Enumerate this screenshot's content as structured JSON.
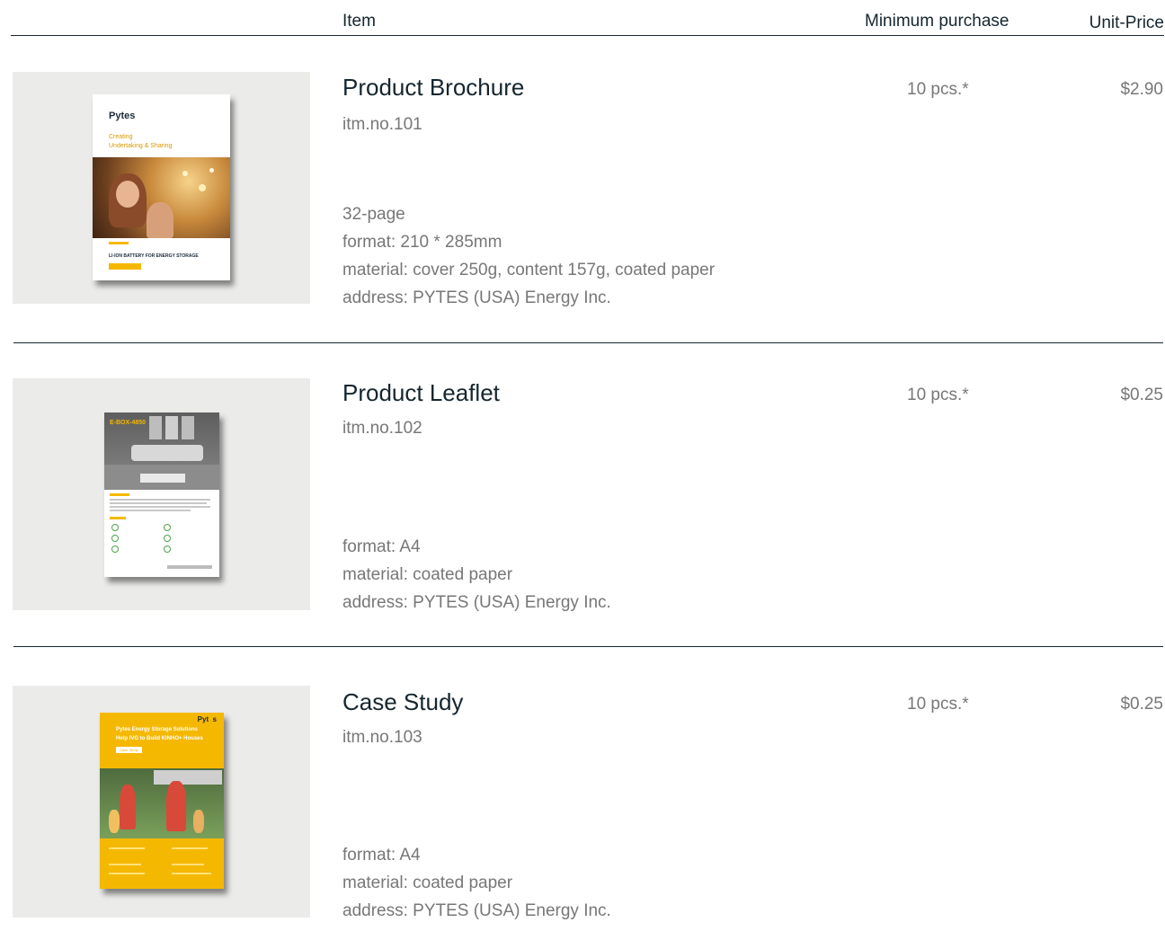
{
  "header": {
    "item_label": "Item",
    "min_purchase_label": "Minimum purchase",
    "unit_price_label": "Unit-Price"
  },
  "products": [
    {
      "title": "Product Brochure",
      "item_no": "itm.no.101",
      "specs": [
        "32-page",
        "format: 210 * 285mm",
        "material: cover 250g, content 157g, coated paper",
        "address: PYTES (USA) Energy Inc."
      ],
      "min_purchase": "10 pcs.*",
      "price": "$2.90",
      "thumb": {
        "brand": "Pytes",
        "headline_1": "Creating",
        "headline_2": "Undertaking & Sharing",
        "footer": "LI-ION BATTERY FOR ENERGY STORAGE"
      }
    },
    {
      "title": "Product Leaflet",
      "item_no": "itm.no.102",
      "specs": [
        "format: A4",
        "material: coated paper",
        "address: PYTES (USA) Energy Inc."
      ],
      "min_purchase": "10 pcs.*",
      "price": "$0.25",
      "thumb": {
        "model": "E-BOX-4850"
      }
    },
    {
      "title": "Case Study",
      "item_no": "itm.no.103",
      "specs": [
        "format: A4",
        "material: coated paper",
        "address: PYTES (USA) Energy Inc."
      ],
      "min_purchase": "10 pcs.*",
      "price": "$0.25",
      "thumb": {
        "brand": "Pyt  s",
        "headline_1": "Pytes Energy Storage Solutions",
        "headline_2": "Help IVG to Build KINHO+ Houses",
        "tag": "Case Study"
      }
    }
  ],
  "colors": {
    "text_dark": "#15262f",
    "text_gray": "#777777",
    "thumb_bg": "#ebebe9",
    "accent_yellow": "#f5b800"
  }
}
